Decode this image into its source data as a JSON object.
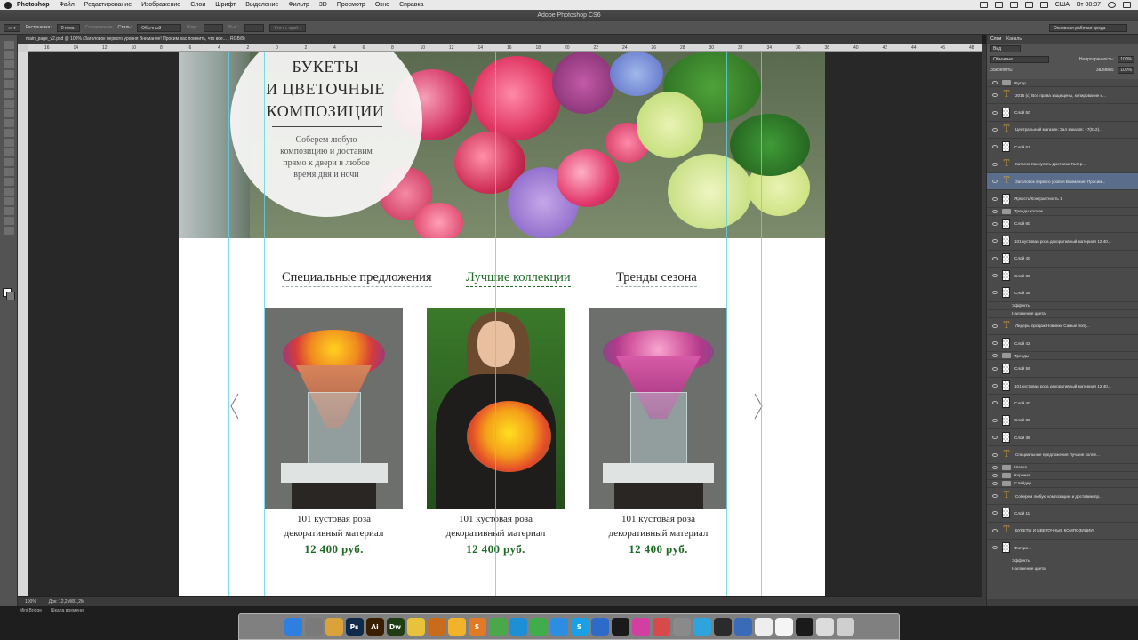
{
  "menubar": {
    "app": "Photoshop",
    "items": [
      "Файл",
      "Редактирование",
      "Изображение",
      "Слои",
      "Шрифт",
      "Выделение",
      "Фильтр",
      "3D",
      "Просмотр",
      "Окно",
      "Справка"
    ],
    "clock": "Вт 08:37",
    "locale": "США"
  },
  "window": {
    "title": "Adobe Photoshop CS6"
  },
  "options_bar": {
    "feather_label": "Растушевка:",
    "feather_value": "0 пикс.",
    "antialias_label": "Сглаживание",
    "style_label": "Стиль:",
    "style_value": "Обычный",
    "width_label": "Шир.:",
    "height_label": "Выс.:",
    "refine_label": "Уточн. край...",
    "workspace": "Основная рабочая среда"
  },
  "document": {
    "tab": "main_page_v2.psd @ 100% (Заголовок первого уровня Внимание! Просим вас помнить, что все... , RGB/8)",
    "zoom": "100%",
    "doc_size": "Док: 12,2M/81,2M",
    "mini_bridge": "Mini Bridge",
    "timeline": "Шкала времени"
  },
  "ruler": {
    "ticks": [
      "16",
      "14",
      "12",
      "10",
      "8",
      "6",
      "4",
      "2",
      "0",
      "2",
      "4",
      "6",
      "8",
      "10",
      "12",
      "14",
      "16",
      "18",
      "20",
      "22",
      "24",
      "26",
      "28",
      "30",
      "32",
      "34",
      "36",
      "38",
      "40",
      "42",
      "44",
      "46",
      "48"
    ]
  },
  "hero": {
    "title_line1": "БУКЕТЫ",
    "title_line2": "И ЦВЕТОЧНЫЕ",
    "title_line3": "КОМПОЗИЦИИ",
    "subtitle_line1": "Соберем любую",
    "subtitle_line2": "композицию и доставим",
    "subtitle_line3": "прямо к двери в любое",
    "subtitle_line4": "время дня и ночи"
  },
  "tabs": [
    {
      "label": "Специальные предложения"
    },
    {
      "label": "Лучшие коллекции"
    },
    {
      "label": "Тренды сезона"
    }
  ],
  "products": [
    {
      "name_line1": "101 кустовая роза",
      "name_line2": "декоративный материал",
      "price": "12 400 руб."
    },
    {
      "name_line1": "101 кустовая роза",
      "name_line2": "декоративный материал",
      "price": "12 400 руб."
    },
    {
      "name_line1": "101 кустовая роза",
      "name_line2": "декоративный материал",
      "price": "12 400 руб."
    }
  ],
  "panel": {
    "tabs": [
      "Слои",
      "Каналы"
    ],
    "filter_label": "Вид",
    "blend_mode": "Обычные",
    "opacity_label": "Непрозрачность:",
    "opacity_value": "100%",
    "lock_label": "Закрепить:",
    "fill_label": "Заливка:",
    "fill_value": "100%"
  },
  "layers": [
    {
      "name": "Футер",
      "kind": "group"
    },
    {
      "name": "2015 (с) Все права защищены, копирование и...",
      "kind": "text"
    },
    {
      "name": "Слой 50",
      "kind": "pixel"
    },
    {
      "name": "Центральный магазин: Зал заказов: +7(812)...",
      "kind": "text"
    },
    {
      "name": "Слой 51",
      "kind": "pixel"
    },
    {
      "name": "Каталог    Как купить    Доставка    Галер...",
      "kind": "text"
    },
    {
      "name": "Заголовок первого уровня Внимание! Просим...",
      "kind": "text",
      "selected": true
    },
    {
      "name": "Яркость/Контрастность 1",
      "kind": "pixel"
    },
    {
      "name": "Тренды коллек",
      "kind": "group"
    },
    {
      "name": "Слой 60",
      "kind": "pixel"
    },
    {
      "name": "101 кустовая роза декоративный материал 12 40...",
      "kind": "pixel"
    },
    {
      "name": "Слой 40",
      "kind": "pixel"
    },
    {
      "name": "Слой 39",
      "kind": "pixel"
    },
    {
      "name": "Слой 36",
      "kind": "pixel"
    },
    {
      "name": "Эффекты",
      "kind": "fx"
    },
    {
      "name": "Наложение цвета",
      "kind": "fx"
    },
    {
      "name": "Лидеры продаж    Новинки    Самые попу...",
      "kind": "text"
    },
    {
      "name": "Слой 42",
      "kind": "pixel"
    },
    {
      "name": "Тренды",
      "kind": "group"
    },
    {
      "name": "Слой 59",
      "kind": "pixel"
    },
    {
      "name": "101 кустовая роза декоративный материал 12 40...",
      "kind": "pixel"
    },
    {
      "name": "Слой 40",
      "kind": "pixel"
    },
    {
      "name": "Слой 39",
      "kind": "pixel"
    },
    {
      "name": "Слой 36",
      "kind": "pixel"
    },
    {
      "name": "Специальные предложения    Лучшие колле...",
      "kind": "text"
    },
    {
      "name": "Шапка",
      "kind": "group"
    },
    {
      "name": "Корзина",
      "kind": "group"
    },
    {
      "name": "Слайдер",
      "kind": "group"
    },
    {
      "name": "Соберем любую композицию и доставим пр...",
      "kind": "text"
    },
    {
      "name": "Слой 11",
      "kind": "pixel"
    },
    {
      "name": "БУКЕТЫ  И ЦВЕТОЧНЫЕ  КОМПОЗИЦИИ",
      "kind": "text"
    },
    {
      "name": "Фигура 1",
      "kind": "pixel"
    },
    {
      "name": "Эффекты",
      "kind": "fx"
    },
    {
      "name": "Наложение цвета",
      "kind": "fx"
    }
  ],
  "dock": [
    {
      "icon": "finder-icon",
      "label": "",
      "color": "#2f7fe0"
    },
    {
      "icon": "launchpad-icon",
      "label": "",
      "color": "#7a7a7a"
    },
    {
      "icon": "chrome-icon",
      "label": "",
      "color": "#d9a23a"
    },
    {
      "icon": "photoshop-icon",
      "label": "Ps",
      "color": "#0f2a4a"
    },
    {
      "icon": "illustrator-icon",
      "label": "Ai",
      "color": "#3a1e00"
    },
    {
      "icon": "dreamweaver-icon",
      "label": "Dw",
      "color": "#1f3d12"
    },
    {
      "icon": "emoji-icon",
      "label": "",
      "color": "#e8c23a"
    },
    {
      "icon": "browser-icon",
      "label": "",
      "color": "#c86b1c"
    },
    {
      "icon": "sketch-icon",
      "label": "",
      "color": "#f2b32a"
    },
    {
      "icon": "sublime-icon",
      "label": "S",
      "color": "#e07a24"
    },
    {
      "icon": "leaf-icon",
      "label": "",
      "color": "#4aa84a"
    },
    {
      "icon": "edge-icon",
      "label": "",
      "color": "#1d8fd6"
    },
    {
      "icon": "chrome2-icon",
      "label": "",
      "color": "#3fae4a"
    },
    {
      "icon": "safari-icon",
      "label": "",
      "color": "#2c8ee0"
    },
    {
      "icon": "skype-icon",
      "label": "S",
      "color": "#19a0e6"
    },
    {
      "icon": "maps-icon",
      "label": "",
      "color": "#2e6bc9"
    },
    {
      "icon": "steam-icon",
      "label": "",
      "color": "#1a1a1a"
    },
    {
      "icon": "itunes-icon",
      "label": "",
      "color": "#d23fa0"
    },
    {
      "icon": "photos-icon",
      "label": "",
      "color": "#d84a4a"
    },
    {
      "icon": "settings-icon",
      "label": "",
      "color": "#8a8a8a"
    },
    {
      "icon": "telegram-icon",
      "label": "",
      "color": "#2fa3dc"
    },
    {
      "icon": "terminal-icon",
      "label": "",
      "color": "#2b2b2b"
    },
    {
      "icon": "app-icon",
      "label": "",
      "color": "#3a6bb8"
    },
    {
      "icon": "doc-icon",
      "label": "",
      "color": "#eeeeee"
    },
    {
      "icon": "doc2-icon",
      "label": "",
      "color": "#f5f5f5"
    },
    {
      "icon": "display-icon",
      "label": "",
      "color": "#1a1a1a"
    },
    {
      "icon": "window-icon",
      "label": "",
      "color": "#dcdcdc"
    },
    {
      "icon": "trash-icon",
      "label": "",
      "color": "#cfcfcf"
    }
  ],
  "colors": {
    "accent_green": "#1e6b26",
    "guide": "#5fd3e6"
  }
}
